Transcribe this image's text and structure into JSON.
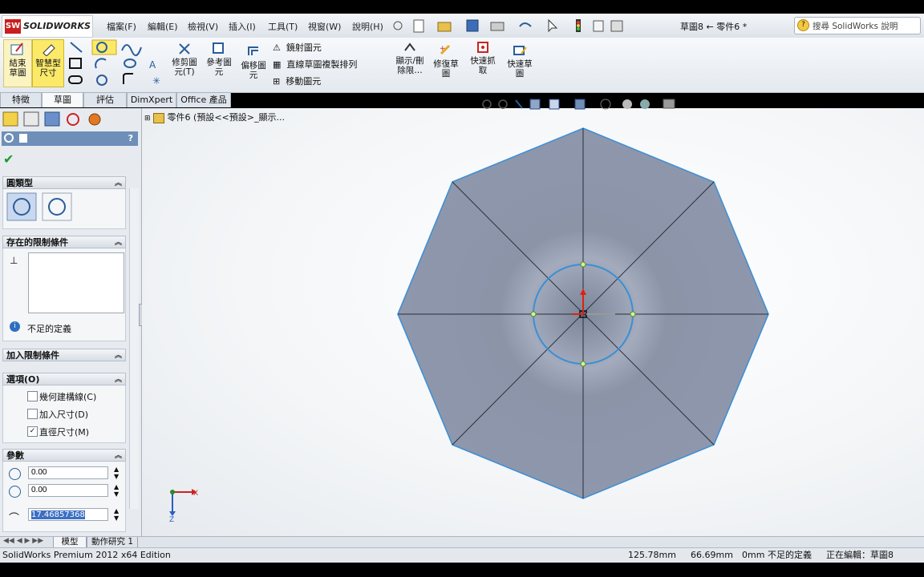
{
  "app": {
    "logo_text": "SOLIDWORKS",
    "logo_mark": "SW",
    "menus": [
      "檔案(F)",
      "編輯(E)",
      "檢視(V)",
      "插入(I)",
      "工具(T)",
      "視窗(W)",
      "說明(H)"
    ],
    "doc_title": "草圖8 ← 零件6 *",
    "search_placeholder": "搜尋 SolidWorks 說明"
  },
  "toolbar": {
    "exit_sketch": "結束\n草圖",
    "smart_dimension": "智慧型\n尺寸",
    "trim": "修剪圖\n元(T)",
    "convert": "參考圖\n元",
    "offset": "偏移圖\n元",
    "mirror": "鏡射圖元",
    "linear_pattern": "直線草圖複製排列",
    "move": "移動圖元",
    "display_relations": "顯示/刪\n除限…",
    "repair": "修復草\n圖",
    "quick_snaps": "快速抓\n取",
    "rapid_sketch": "快速草\n圖"
  },
  "tabs": [
    "特徵",
    "草圖",
    "評估",
    "DimXpert",
    "Office 產品"
  ],
  "active_tab": "草圖",
  "tree": {
    "root": "零件6 (預設<<預設>_顯示..."
  },
  "panel": {
    "help": "?",
    "circle_type_title": "圓類型",
    "existing_relations_title": "存在的限制條件",
    "status_text": "不足的定義",
    "add_relations_title": "加入限制條件",
    "options_title": "選項(O)",
    "options": [
      {
        "label": "幾何建構線(C)",
        "checked": false
      },
      {
        "label": "加入尺寸(D)",
        "checked": false
      },
      {
        "label": "直徑尺寸(M)",
        "checked": true
      }
    ],
    "params_title": "參數",
    "cx": "0.00",
    "cy": "0.00",
    "radius": "17.46857368"
  },
  "bottom_tabs": [
    "模型",
    "動作研究 1"
  ],
  "status": {
    "edition": "SolidWorks Premium 2012 x64 Edition",
    "x": "125.78mm",
    "y": "66.69mm",
    "z": "0mm",
    "definition": "不足的定義",
    "editing": "正在編輯：草圖8"
  },
  "colors": {
    "part_fill": "#8f98ad",
    "sketch_blue": "#3a8fd6",
    "accent_red": "#c81e1e"
  }
}
